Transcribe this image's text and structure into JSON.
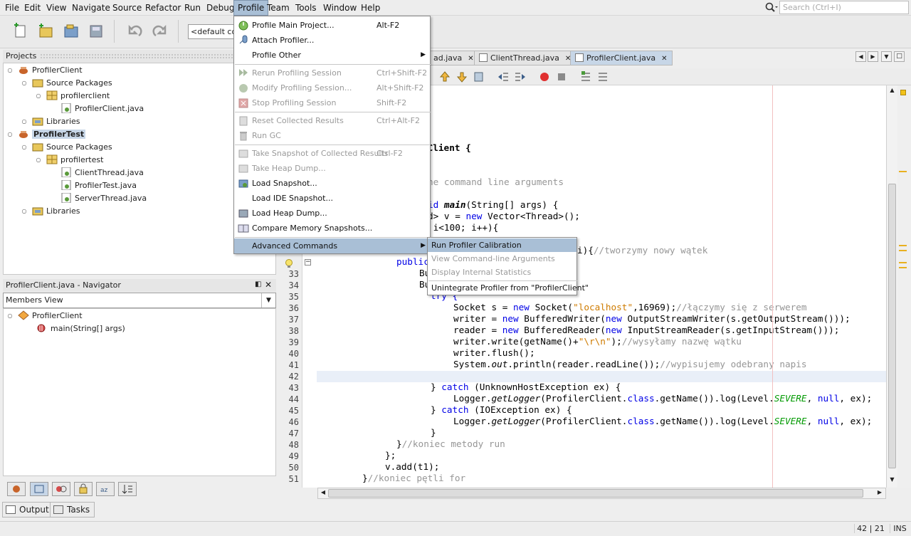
{
  "menubar": {
    "items": [
      "File",
      "Edit",
      "View",
      "Navigate",
      "Source",
      "Refactor",
      "Run",
      "Debug",
      "Profile",
      "Team",
      "Tools",
      "Window",
      "Help"
    ],
    "search_placeholder": "Search (Ctrl+I)"
  },
  "toolbar": {
    "config_combo": "<default config>"
  },
  "projects": {
    "title": "Projects",
    "tree": [
      {
        "label": "ProfilerClient",
        "icon": "project-icon"
      },
      {
        "label": "Source Packages",
        "icon": "source-packages-icon"
      },
      {
        "label": "profilerclient",
        "icon": "package-icon"
      },
      {
        "label": "ProfilerClient.java",
        "icon": "java-file-icon"
      },
      {
        "label": "Libraries",
        "icon": "libraries-icon"
      },
      {
        "label": "ProfilerTest",
        "icon": "project-icon"
      },
      {
        "label": "Source Packages",
        "icon": "source-packages-icon"
      },
      {
        "label": "profilertest",
        "icon": "package-icon"
      },
      {
        "label": "ClientThread.java",
        "icon": "java-file-icon"
      },
      {
        "label": "ProfilerTest.java",
        "icon": "java-file-icon"
      },
      {
        "label": "ServerThread.java",
        "icon": "java-file-icon"
      },
      {
        "label": "Libraries",
        "icon": "libraries-icon"
      }
    ]
  },
  "navigator": {
    "title": "ProfilerClient.java - Navigator",
    "view": "Members View",
    "items": [
      {
        "label": "ProfilerClient"
      },
      {
        "label": "main(String[] args)"
      }
    ]
  },
  "editor": {
    "tabs": [
      {
        "label": "ad.java"
      },
      {
        "label": "ClientThread.java"
      },
      {
        "label": "ProfilerClient.java"
      }
    ],
    "lines": {
      "l_top1": "rClient {",
      "l_top2": "he command line arguments",
      "l_top3a": "id ",
      "l_top3b": "main",
      "l_top3c": "(String[] args) {",
      "l_top4a": "d> v = ",
      "l_top4b": "new",
      "l_top4c": " Vector<Thread>();",
      "l_top5": " i<100; i++){",
      "l_top6a": "i){",
      "l_top6b": "//tworzymy nowy wątek",
      "l33": "public",
      "l33b": "Bu",
      "l34b": "Bu",
      "l35": "try {",
      "l36a": "Socket s = ",
      "l36b": "new",
      "l36c": " Socket(",
      "l36d": "\"localhost\"",
      "l36e": ",16969);",
      "l36f": "//łączymy się z serwerem",
      "l37a": "writer = ",
      "l37b": "new",
      "l37c": " BufferedWriter(",
      "l37d": "new",
      "l37e": " OutputStreamWriter(s.getOutputStream()));",
      "l38a": "reader = ",
      "l38b": "new",
      "l38c": " BufferedReader(",
      "l38d": "new",
      "l38e": " InputStreamReader(s.getInputStream()));",
      "l39a": "writer.write(getName()+",
      "l39b": "\"\\r\\n\"",
      "l39c": ");",
      "l39d": "//wysyłamy nazwę wątku",
      "l40": "writer.flush();",
      "l41a": "System.",
      "l41b": "out",
      "l41c": ".println(reader.readLine());",
      "l41d": "//wypisujemy odebrany napis",
      "l43a": "} ",
      "l43b": "catch",
      "l43c": " (UnknownHostException ex) {",
      "l44a": "Logger.",
      "l44b": "getLogger",
      "l44c": "(ProfilerClient.",
      "l44d": "class",
      "l44e": ".getName()).log(Level.",
      "l44f": "SEVERE",
      "l44g": ", ",
      "l44h": "null",
      "l44i": ", ex);",
      "l45a": "} ",
      "l45b": "catch",
      "l45c": " (IOException ex) {",
      "l47": "}",
      "l48a": "}",
      "l48b": "//koniec metody run",
      "l49": "};",
      "l50": "v.add(t1);",
      "l51a": "}",
      "l51b": "//koniec pętli for"
    },
    "line_numbers": [
      "33",
      "34",
      "35",
      "36",
      "37",
      "38",
      "39",
      "40",
      "41",
      "42",
      "43",
      "44",
      "45",
      "46",
      "47",
      "48",
      "49",
      "50",
      "51"
    ]
  },
  "profile_menu": {
    "items": [
      {
        "label": "Profile Main Project...",
        "accel": "Alt-F2",
        "enabled": true
      },
      {
        "label": "Attach Profiler...",
        "accel": "",
        "enabled": true
      },
      {
        "label": "Profile Other",
        "accel": "",
        "enabled": true
      },
      {
        "label": "Rerun Profiling Session",
        "accel": "Ctrl+Shift-F2",
        "enabled": false
      },
      {
        "label": "Modify Profiling Session...",
        "accel": "Alt+Shift-F2",
        "enabled": false
      },
      {
        "label": "Stop Profiling Session",
        "accel": "Shift-F2",
        "enabled": false
      },
      {
        "label": "Reset Collected Results",
        "accel": "Ctrl+Alt-F2",
        "enabled": false
      },
      {
        "label": "Run GC",
        "accel": "",
        "enabled": false
      },
      {
        "label": "Take Snapshot of Collected Results",
        "accel": "Ctrl-F2",
        "enabled": false
      },
      {
        "label": "Take Heap Dump...",
        "accel": "",
        "enabled": false
      },
      {
        "label": "Load Snapshot...",
        "accel": "",
        "enabled": true
      },
      {
        "label": "Load IDE Snapshot...",
        "accel": "",
        "enabled": true
      },
      {
        "label": "Load Heap Dump...",
        "accel": "",
        "enabled": true
      },
      {
        "label": "Compare Memory Snapshots...",
        "accel": "",
        "enabled": true
      },
      {
        "label": "Advanced Commands",
        "accel": "",
        "enabled": true
      }
    ]
  },
  "advanced_menu": {
    "items": [
      {
        "label": "Run Profiler Calibration",
        "enabled": true
      },
      {
        "label": "View Command-line Arguments",
        "enabled": false
      },
      {
        "label": "Display Internal Statistics",
        "enabled": false
      },
      {
        "label": "Unintegrate Profiler from \"ProfilerClient\"",
        "enabled": true
      }
    ]
  },
  "bottom": {
    "output": "Output",
    "tasks": "Tasks"
  },
  "status": {
    "position": "42 | 21",
    "mode": "INS"
  }
}
